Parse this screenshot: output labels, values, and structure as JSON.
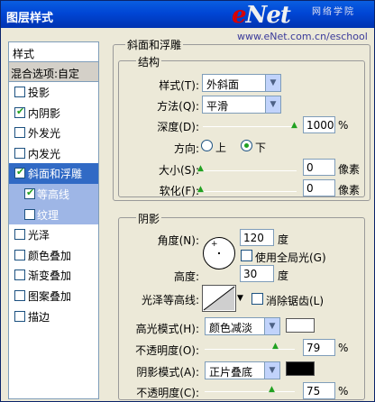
{
  "window": {
    "title": "图层样式"
  },
  "watermark": {
    "logo_e": "e",
    "logo_rest": "Net",
    "cn": "网络学院",
    "url": "www.eNet.com.cn/eschool"
  },
  "sidebar": {
    "header": "样式",
    "blend": "混合选项:自定",
    "items": [
      {
        "label": "投影",
        "checked": false
      },
      {
        "label": "内阴影",
        "checked": true
      },
      {
        "label": "外发光",
        "checked": false
      },
      {
        "label": "内发光",
        "checked": false
      },
      {
        "label": "斜面和浮雕",
        "checked": true,
        "state": "selected"
      },
      {
        "label": "等高线",
        "checked": true,
        "state": "sub"
      },
      {
        "label": "纹理",
        "checked": false,
        "state": "sub"
      },
      {
        "label": "光泽",
        "checked": false
      },
      {
        "label": "颜色叠加",
        "checked": false
      },
      {
        "label": "渐变叠加",
        "checked": false
      },
      {
        "label": "图案叠加",
        "checked": false
      },
      {
        "label": "描边",
        "checked": false
      }
    ]
  },
  "bevel": {
    "group_title": "斜面和浮雕",
    "structure": {
      "title": "结构",
      "style_label": "样式(T):",
      "style_value": "外斜面",
      "technique_label": "方法(Q):",
      "technique_value": "平滑",
      "depth_label": "深度(D):",
      "depth_value": "1000",
      "depth_unit": "%",
      "depth_level": 1.0,
      "direction_label": "方向:",
      "dir_up": "上",
      "dir_down": "下",
      "direction_selected": "下",
      "size_label": "大小(S):",
      "size_value": "0",
      "size_unit": "像素",
      "size_level": 0,
      "soften_label": "软化(F):",
      "soften_value": "0",
      "soften_unit": "像素",
      "soften_level": 0
    },
    "shading": {
      "title": "阴影",
      "angle_label": "角度(N):",
      "angle_value": "120",
      "angle_unit": "度",
      "global_light_label": "使用全局光(G)",
      "global_light_checked": false,
      "altitude_label": "高度:",
      "altitude_value": "30",
      "altitude_unit": "度",
      "gloss_label": "光泽等高线:",
      "antialias_label": "消除锯齿(L)",
      "antialias_checked": false,
      "highlight_mode_label": "高光模式(H):",
      "highlight_mode_value": "颜色减淡",
      "highlight_color": "#ffffff",
      "highlight_opacity_label": "不透明度(O):",
      "highlight_opacity_value": "79",
      "highlight_opacity_unit": "%",
      "highlight_opacity_level": 0.79,
      "shadow_mode_label": "阴影模式(A):",
      "shadow_mode_value": "正片叠底",
      "shadow_color": "#000000",
      "shadow_opacity_label": "不透明度(C):",
      "shadow_opacity_value": "75",
      "shadow_opacity_unit": "%",
      "shadow_opacity_level": 0.75
    }
  }
}
